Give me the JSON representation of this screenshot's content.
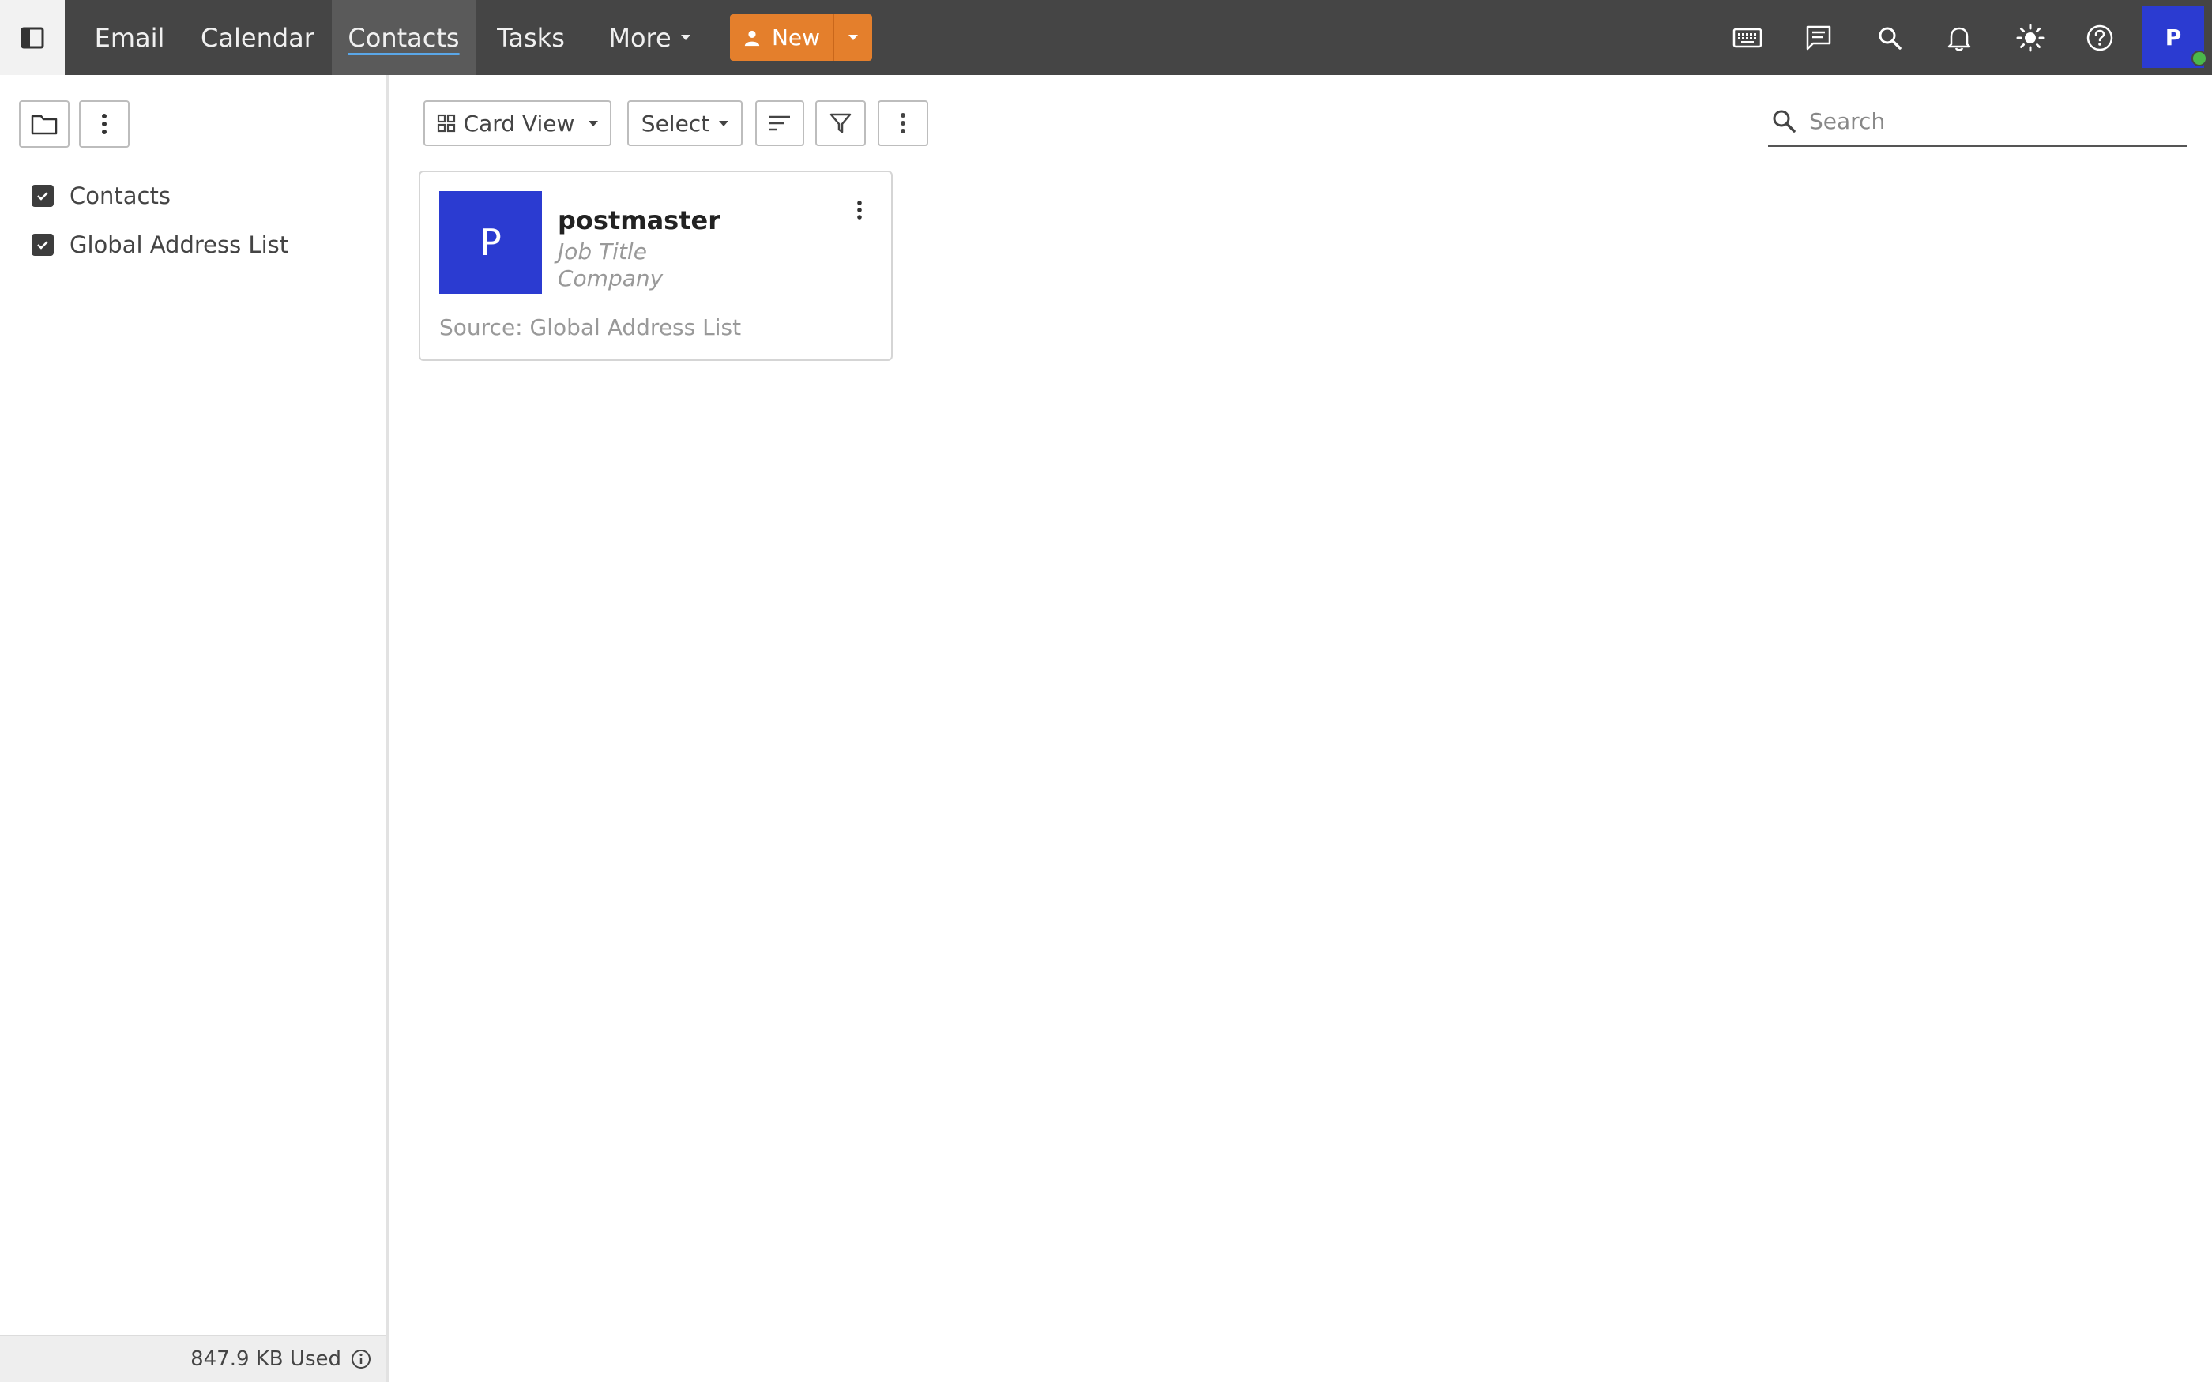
{
  "nav": {
    "sidebar_toggle_icon": "sidebar-toggle-icon",
    "items": [
      {
        "label": "Email"
      },
      {
        "label": "Calendar"
      },
      {
        "label": "Contacts",
        "active": true
      },
      {
        "label": "Tasks"
      },
      {
        "label": "More"
      }
    ],
    "new_label": "New",
    "accent_color": "#e47f2c",
    "icons": [
      "keyboard-icon",
      "chat-icon",
      "search-icon",
      "bell-icon",
      "theme-icon",
      "help-icon"
    ],
    "avatar_initial": "P"
  },
  "sidebar": {
    "folders": [
      {
        "label": "Contacts",
        "checked": true
      },
      {
        "label": "Global Address List",
        "checked": true
      }
    ],
    "storage_label": "847.9 KB Used"
  },
  "toolbar": {
    "view_label": "Card View",
    "select_label": "Select",
    "search_placeholder": "Search"
  },
  "contacts": [
    {
      "initial": "P",
      "name": "postmaster",
      "job_title": "Job Title",
      "company": "Company",
      "source": "Source: Global Address List",
      "avatar_color": "#2b3bd1"
    }
  ]
}
